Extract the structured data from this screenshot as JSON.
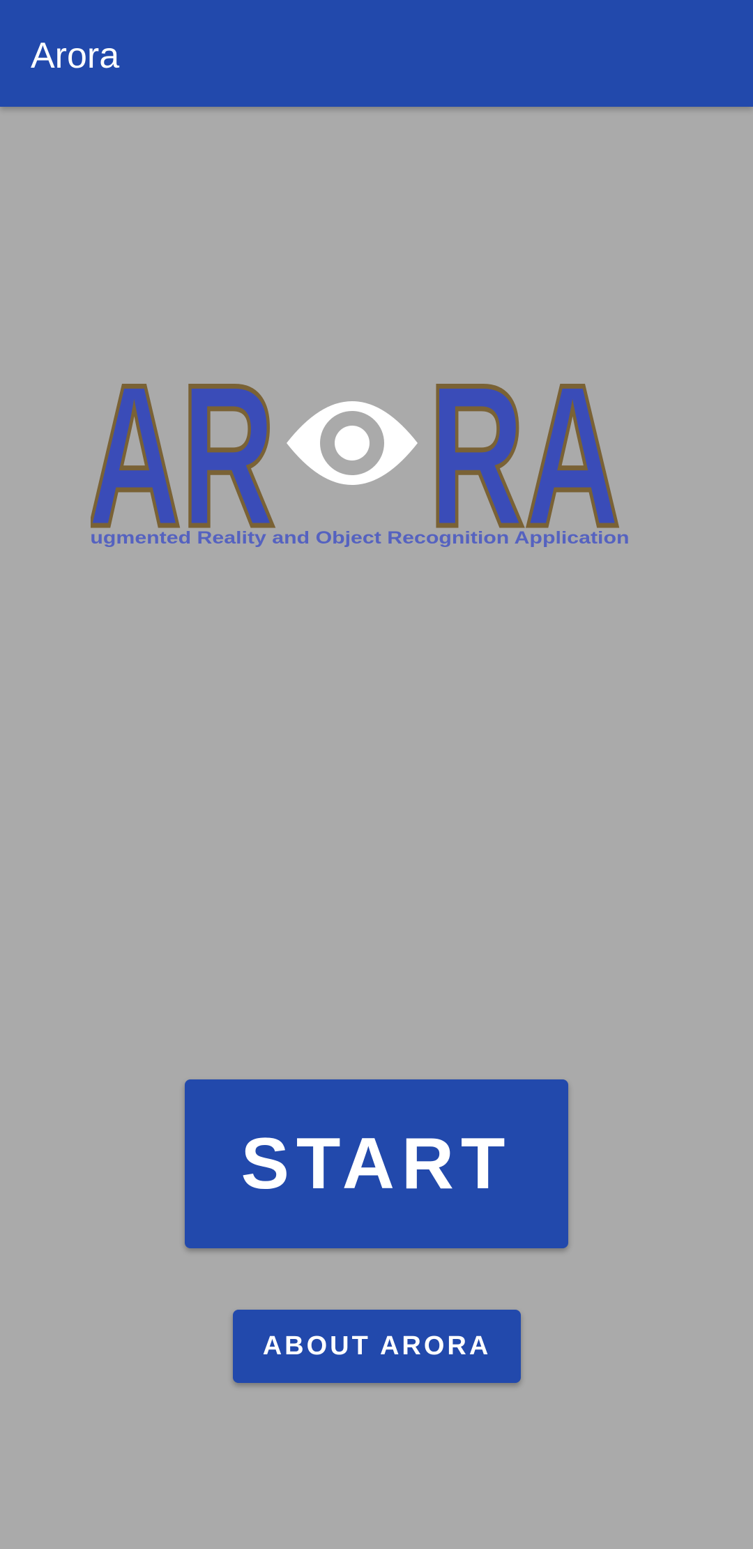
{
  "app_bar": {
    "title": "Arora",
    "background": "#2249ac"
  },
  "logo": {
    "wordmark_left": "AR",
    "wordmark_right": "RA",
    "tagline": "Augmented Reality and Object Recognition Application",
    "letter_color": "#3a4cb8",
    "outline_color": "#7a6235",
    "eye_color": "#ffffff",
    "pupil_color": "#aaaaaa",
    "icon": "eye-icon"
  },
  "buttons": {
    "start_label": "START",
    "about_label": "ABOUT ARORA"
  },
  "colors": {
    "screen_background": "#aaaaaa",
    "button_background": "#2249ac",
    "button_text": "#ffffff"
  }
}
